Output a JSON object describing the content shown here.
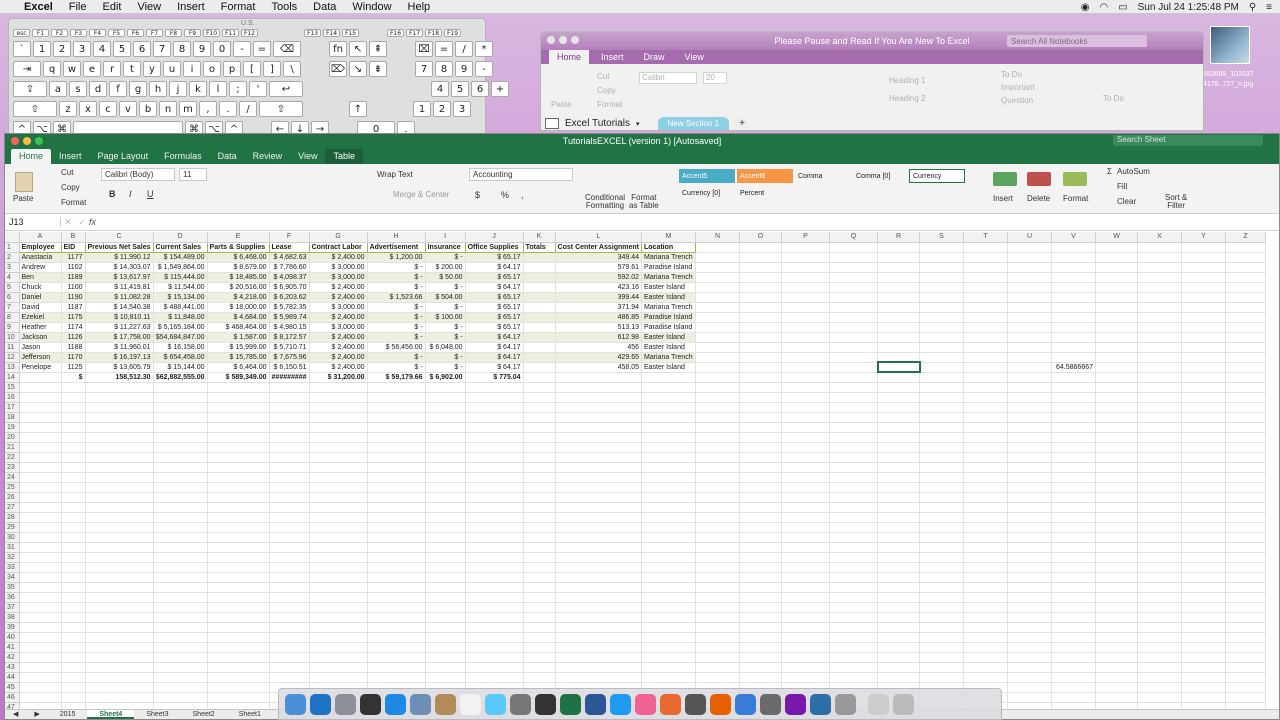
{
  "menubar": {
    "app": "Excel",
    "items": [
      "File",
      "Edit",
      "View",
      "Insert",
      "Format",
      "Tools",
      "Data",
      "Window",
      "Help"
    ],
    "datetime": "Sun Jul 24  1:25:48 PM"
  },
  "keyboard": {
    "label": "U.S.",
    "fkeys": [
      "esc",
      "F1",
      "F2",
      "F3",
      "F4",
      "F5",
      "F6",
      "F7",
      "F8",
      "F9",
      "F10",
      "F11",
      "F12"
    ],
    "fkeys2": [
      "F13",
      "F14",
      "F15"
    ],
    "fkeys3": [
      "F16",
      "F17",
      "F18",
      "F19"
    ],
    "row1": [
      "`",
      "1",
      "2",
      "3",
      "4",
      "5",
      "6",
      "7",
      "8",
      "9",
      "0",
      "-",
      "=",
      "⌫"
    ],
    "row2": [
      "⇥",
      "q",
      "w",
      "e",
      "r",
      "t",
      "y",
      "u",
      "i",
      "o",
      "p",
      "[",
      "]",
      "\\"
    ],
    "row3": [
      "⇪",
      "a",
      "s",
      "d",
      "f",
      "g",
      "h",
      "j",
      "k",
      "l",
      ";",
      "'",
      "↩"
    ],
    "row4": [
      "⇧",
      "z",
      "x",
      "c",
      "v",
      "b",
      "n",
      "m",
      ",",
      ".",
      "/",
      "⇧"
    ],
    "row5": [
      "^",
      "⌥",
      "⌘",
      "",
      "⌘",
      "⌥",
      "^"
    ],
    "nav1": [
      "fn",
      "↖",
      "⇞"
    ],
    "nav2": [
      "⌦",
      "↘",
      "⇟"
    ],
    "nav5": [
      "←",
      "↓",
      "→"
    ],
    "num1": [
      "⌧",
      "=",
      "/",
      "*"
    ],
    "num2": [
      "7",
      "8",
      "9",
      "-"
    ],
    "num3": [
      "4",
      "5",
      "6",
      "+"
    ],
    "num4": [
      "1",
      "2",
      "3"
    ],
    "num5": [
      "0",
      "."
    ]
  },
  "onenote": {
    "title": "Please Pause and Read If You Are New To Excel",
    "tabs": [
      "Home",
      "Insert",
      "Draw",
      "View"
    ],
    "search_placeholder": "Search All Notebooks",
    "notebook": "Excel Tutorials",
    "section": "New Section 1",
    "add_tab": "+",
    "ribbon": {
      "cut": "Cut",
      "copy": "Copy",
      "format": "Format",
      "paste": "Paste",
      "font": "Calibri",
      "size": "20",
      "heading1": "Heading 1",
      "heading2": "Heading 2",
      "todo": "To Do",
      "important": "Important",
      "question": "Question",
      "todo_btn": "To Do"
    }
  },
  "photo_label": "553689_102037\n4178..727_n.jpg",
  "excel": {
    "title": "TutorialsEXCEL (version 1) [Autosaved]",
    "search_placeholder": "Search Sheet",
    "tabs": [
      "Home",
      "Insert",
      "Page Layout",
      "Formulas",
      "Data",
      "Review",
      "View",
      "Table"
    ],
    "ribbon": {
      "paste": "Paste",
      "cut": "Cut",
      "copy": "Copy",
      "format": "Format",
      "font": "Calibri (Body)",
      "size": "11",
      "bold": "B",
      "italic": "I",
      "underline": "U",
      "wrap": "Wrap Text",
      "merge": "Merge & Center",
      "numfmt": "Accounting",
      "currency_sym": "$",
      "percent_sym": "%",
      "comma_sym": ",",
      "cond": "Conditional\nFormatting",
      "fmt_table": "Format\nas Table",
      "styles": [
        "Accent5",
        "Accent6",
        "Comma",
        "Comma [0]",
        "Currency",
        "Currency [0]",
        "Percent"
      ],
      "insert": "Insert",
      "delete": "Delete",
      "formatcell": "Format",
      "autosum": "AutoSum",
      "fill": "Fill",
      "clear": "Clear",
      "sort": "Sort &\nFilter"
    },
    "namebox": "J13",
    "fx": "fx",
    "formula_value": "",
    "columns": [
      "A",
      "B",
      "C",
      "D",
      "E",
      "F",
      "G",
      "H",
      "I",
      "J",
      "K",
      "L",
      "M",
      "N",
      "O",
      "P",
      "Q",
      "R",
      "S",
      "T",
      "U",
      "V",
      "W",
      "X",
      "Y",
      "Z"
    ],
    "headers": [
      "Employee",
      "EID",
      "Previous Net Sales",
      "Current Sales",
      "Parts & Supplies",
      "Lease",
      "Contract Labor",
      "Advertisement",
      "Insurance",
      "Office Supplies",
      "Totals",
      "Cost Center Assignment",
      "Location"
    ],
    "rows": [
      [
        "Anastacia",
        "1177",
        "$       11,990.12",
        "$      154,489.00",
        "$        6,468.00",
        "$ 4,682.63",
        "$       2,400.00",
        "$       1,200.00",
        "$          -",
        "$        65.17",
        "",
        "349.44",
        "Mariana Trench"
      ],
      [
        "Andrew",
        "1102",
        "$       14,303.07",
        "$   1,549,864.00",
        "$        8,679.00",
        "$ 7,786.60",
        "$       3,000.00",
        "$           -",
        "$    200.00",
        "$        64.17",
        "",
        "579.61",
        "Paradise Island"
      ],
      [
        "Ben",
        "1189",
        "$       13,617.97",
        "$      115,444.00",
        "$      18,485.00",
        "$ 4,098.37",
        "$       3,000.00",
        "$           -",
        "$      50.00",
        "$        65.17",
        "",
        "592.02",
        "Mariana Trench"
      ],
      [
        "Chuck",
        "1100",
        "$       11,419.81",
        "$        11,544.00",
        "$      20,516.00",
        "$ 6,905.70",
        "$       2,400.00",
        "$           -",
        "$          -",
        "$        64.17",
        "",
        "423.16",
        "Easter Island"
      ],
      [
        "Daniel",
        "1190",
        "$       11,082.28",
        "$        15,134.00",
        "$        4,218.00",
        "$ 6,203.62",
        "$       2,400.00",
        "$       1,523.66",
        "$    504.00",
        "$        65.17",
        "",
        "399.44",
        "Easter Island"
      ],
      [
        "David",
        "1187",
        "$       14,540.38",
        "$      488,441.00",
        "$      18,000.00",
        "$ 5,782.35",
        "$       3,000.00",
        "$           -",
        "$          -",
        "$        65.17",
        "",
        "371.94",
        "Mariana Trench"
      ],
      [
        "Ezekiel",
        "1175",
        "$       10,810.11",
        "$        11,848.00",
        "$        4,684.00",
        "$ 5,989.74",
        "$       2,400.00",
        "$           -",
        "$    100.00",
        "$        65.17",
        "",
        "486.85",
        "Paradise Island"
      ],
      [
        "Heather",
        "1174",
        "$       11,227.63",
        "$   5,165,184.00",
        "$    468,464.00",
        "$ 4,980.15",
        "$       3,000.00",
        "$           -",
        "$          -",
        "$        65.17",
        "",
        "513.13",
        "Paradise Island"
      ],
      [
        "Jackson",
        "1126",
        "$       17,758.00",
        "$54,684,847.00",
        "$        1,587.00",
        "$ 8,172.57",
        "$       2,400.00",
        "$           -",
        "$          -",
        "$        64.17",
        "",
        "612.98",
        "Easter Island"
      ],
      [
        "Jason",
        "1188",
        "$       11,960.01",
        "$        16,158.00",
        "$      15,999.00",
        "$ 5,710.71",
        "$       2,400.00",
        "$     56,456.00",
        "$ 6,048.00",
        "$        64.17",
        "",
        "456",
        "Easter Island"
      ],
      [
        "Jefferson",
        "1170",
        "$       16,197.13",
        "$      654,458.00",
        "$      15,785.00",
        "$ 7,675.96",
        "$       2,400.00",
        "$           -",
        "$          -",
        "$        64.17",
        "",
        "429.65",
        "Mariana Trench"
      ],
      [
        "Penelope",
        "1125",
        "$       13,605.79",
        "$        15,144.00",
        "$        6,464.00",
        "$ 6,150.51",
        "$       2,400.00",
        "$           -",
        "$          -",
        "$        64.17",
        "",
        "458.05",
        "Easter Island"
      ]
    ],
    "totals": [
      "",
      "$",
      "158,512.30",
      "$62,882,555.00",
      "$    589,349.00",
      "#########",
      "$     31,200.00",
      "$     59,179.66",
      "$ 6,902.00",
      "$      775.04",
      "",
      "",
      ""
    ],
    "r13_value": "64.5866667",
    "sheet_tabs": [
      "2015",
      "Sheet4",
      "Sheet3",
      "Sheet2",
      "Sheet1"
    ]
  }
}
